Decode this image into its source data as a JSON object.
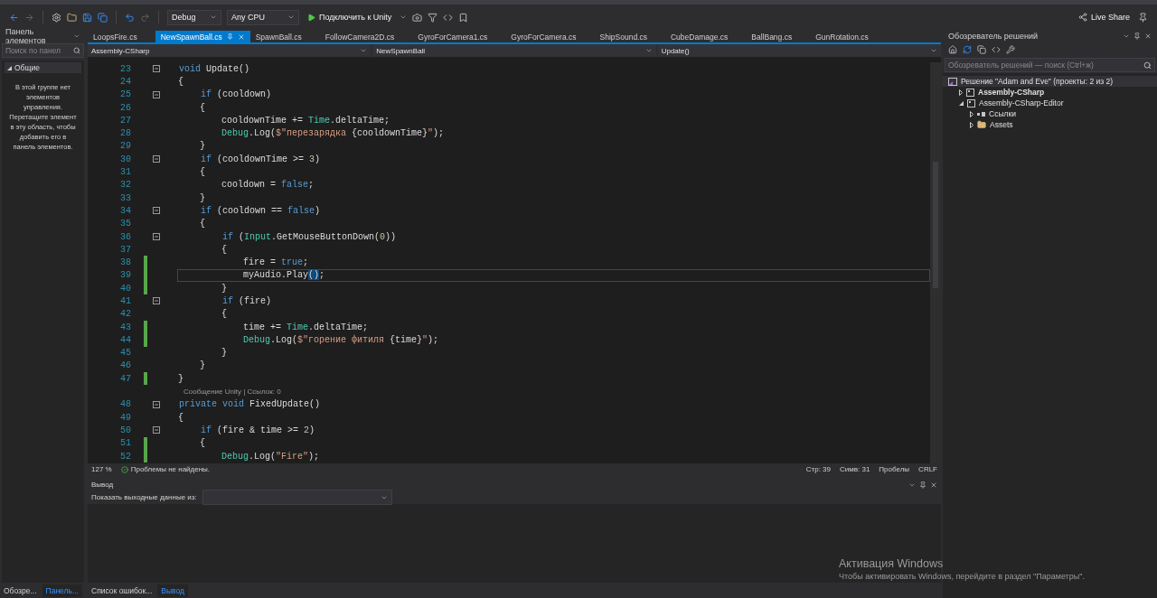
{
  "toolbar": {
    "config": "Debug",
    "platform": "Any CPU",
    "run_label": "Подключить к Unity",
    "live_share": "Live Share"
  },
  "toolbox": {
    "title": "Панель элементов",
    "search": {
      "placeholder": "Поиск по панел"
    },
    "group": {
      "label": "Общие",
      "expanded": true
    },
    "message": "В этой группе нет элементов управления. Перетащите элемент в эту область, чтобы добавить его в панель элементов."
  },
  "tabs": [
    {
      "label": "LoopsFire.cs",
      "selected": false
    },
    {
      "label": "NewSpawnBall.cs",
      "selected": true
    },
    {
      "label": "SpawnBall.cs",
      "selected": false
    },
    {
      "label": "FollowCamera2D.cs",
      "selected": false
    },
    {
      "label": "GyroForCamera1.cs",
      "selected": false
    },
    {
      "label": "GyroForCamera.cs",
      "selected": false
    },
    {
      "label": "ShipSound.cs",
      "selected": false
    },
    {
      "label": "CubeDamage.cs",
      "selected": false
    },
    {
      "label": "BallBang.cs",
      "selected": false
    },
    {
      "label": "GunRotation.cs",
      "selected": false
    }
  ],
  "navbar": {
    "project": "Assembly-CSharp",
    "class": "NewSpawnBall",
    "member": "Update()"
  },
  "code": [
    {
      "kind": "code",
      "number": "23",
      "fold": true,
      "changed": false,
      "current": false,
      "tokens": [
        {
          "kind": "kw",
          "text": "void "
        },
        {
          "kind": "p",
          "text": "Update()"
        }
      ]
    },
    {
      "kind": "code",
      "number": "24",
      "fold": false,
      "changed": false,
      "current": false,
      "tokens": [
        {
          "kind": "p",
          "text": "{"
        }
      ]
    },
    {
      "kind": "code",
      "number": "25",
      "fold": true,
      "changed": false,
      "current": false,
      "tokens": [
        {
          "kind": "kw",
          "text": "    if"
        },
        {
          "kind": "p",
          "text": " (cooldown)"
        }
      ]
    },
    {
      "kind": "code",
      "number": "26",
      "fold": false,
      "changed": false,
      "current": false,
      "tokens": [
        {
          "kind": "p",
          "text": "    {"
        }
      ]
    },
    {
      "kind": "code",
      "number": "27",
      "fold": false,
      "changed": false,
      "current": false,
      "tokens": [
        {
          "kind": "p",
          "text": "        cooldownTime += "
        },
        {
          "kind": "type",
          "text": "Time"
        },
        {
          "kind": "p",
          "text": ".deltaTime;"
        }
      ]
    },
    {
      "kind": "code",
      "number": "28",
      "fold": false,
      "changed": false,
      "current": false,
      "tokens": [
        {
          "kind": "type",
          "text": "        Debug"
        },
        {
          "kind": "p",
          "text": ".Log("
        },
        {
          "kind": "str",
          "text": "$\"перезарядка "
        },
        {
          "kind": "p",
          "text": "{cooldownTime}"
        },
        {
          "kind": "str",
          "text": "\""
        },
        {
          "kind": "p",
          "text": ");"
        }
      ]
    },
    {
      "kind": "code",
      "number": "29",
      "fold": false,
      "changed": false,
      "current": false,
      "tokens": [
        {
          "kind": "p",
          "text": "    }"
        }
      ]
    },
    {
      "kind": "code",
      "number": "30",
      "fold": true,
      "changed": false,
      "current": false,
      "tokens": [
        {
          "kind": "kw",
          "text": "    if"
        },
        {
          "kind": "p",
          "text": " (cooldownTime >= "
        },
        {
          "kind": "num",
          "text": "3"
        },
        {
          "kind": "p",
          "text": ")"
        }
      ]
    },
    {
      "kind": "code",
      "number": "31",
      "fold": false,
      "changed": false,
      "current": false,
      "tokens": [
        {
          "kind": "p",
          "text": "    {"
        }
      ]
    },
    {
      "kind": "code",
      "number": "32",
      "fold": false,
      "changed": false,
      "current": false,
      "tokens": [
        {
          "kind": "p",
          "text": "        cooldown = "
        },
        {
          "kind": "kw",
          "text": "false"
        },
        {
          "kind": "p",
          "text": ";"
        }
      ]
    },
    {
      "kind": "code",
      "number": "33",
      "fold": false,
      "changed": false,
      "current": false,
      "tokens": [
        {
          "kind": "p",
          "text": "    }"
        }
      ]
    },
    {
      "kind": "code",
      "number": "34",
      "fold": true,
      "changed": false,
      "current": false,
      "tokens": [
        {
          "kind": "kw",
          "text": "    if"
        },
        {
          "kind": "p",
          "text": " (cooldown == "
        },
        {
          "kind": "kw",
          "text": "false"
        },
        {
          "kind": "p",
          "text": ")"
        }
      ]
    },
    {
      "kind": "code",
      "number": "35",
      "fold": false,
      "changed": false,
      "current": false,
      "tokens": [
        {
          "kind": "p",
          "text": "    {"
        }
      ]
    },
    {
      "kind": "code",
      "number": "36",
      "fold": true,
      "changed": false,
      "current": false,
      "tokens": [
        {
          "kind": "kw",
          "text": "        if"
        },
        {
          "kind": "p",
          "text": " ("
        },
        {
          "kind": "type",
          "text": "Input"
        },
        {
          "kind": "p",
          "text": ".GetMouseButtonDown("
        },
        {
          "kind": "num",
          "text": "0"
        },
        {
          "kind": "p",
          "text": "))"
        }
      ]
    },
    {
      "kind": "code",
      "number": "37",
      "fold": false,
      "changed": false,
      "current": false,
      "tokens": [
        {
          "kind": "p",
          "text": "        {"
        }
      ]
    },
    {
      "kind": "code",
      "number": "38",
      "fold": false,
      "changed": true,
      "current": false,
      "tokens": [
        {
          "kind": "p",
          "text": "            fire = "
        },
        {
          "kind": "kw",
          "text": "true"
        },
        {
          "kind": "p",
          "text": ";"
        }
      ]
    },
    {
      "kind": "code",
      "number": "39",
      "fold": false,
      "changed": true,
      "current": true,
      "tokens": [
        {
          "kind": "p",
          "text": "            myAudio.Play"
        },
        {
          "kind": "match",
          "text": "()"
        },
        {
          "kind": "p",
          "text": ";"
        }
      ]
    },
    {
      "kind": "code",
      "number": "40",
      "fold": false,
      "changed": true,
      "current": false,
      "tokens": [
        {
          "kind": "p",
          "text": "        }"
        }
      ]
    },
    {
      "kind": "code",
      "number": "41",
      "fold": true,
      "changed": false,
      "current": false,
      "tokens": [
        {
          "kind": "kw",
          "text": "        if"
        },
        {
          "kind": "p",
          "text": " (fire)"
        }
      ]
    },
    {
      "kind": "code",
      "number": "42",
      "fold": false,
      "changed": false,
      "current": false,
      "tokens": [
        {
          "kind": "p",
          "text": "        {"
        }
      ]
    },
    {
      "kind": "code",
      "number": "43",
      "fold": false,
      "changed": true,
      "current": false,
      "tokens": [
        {
          "kind": "p",
          "text": "            time += "
        },
        {
          "kind": "type",
          "text": "Time"
        },
        {
          "kind": "p",
          "text": ".deltaTime;"
        }
      ]
    },
    {
      "kind": "code",
      "number": "44",
      "fold": false,
      "changed": true,
      "current": false,
      "tokens": [
        {
          "kind": "type",
          "text": "            Debug"
        },
        {
          "kind": "p",
          "text": ".Log("
        },
        {
          "kind": "str",
          "text": "$\"горение фитиля "
        },
        {
          "kind": "p",
          "text": "{time}"
        },
        {
          "kind": "str",
          "text": "\""
        },
        {
          "kind": "p",
          "text": ");"
        }
      ]
    },
    {
      "kind": "code",
      "number": "45",
      "fold": false,
      "changed": false,
      "current": false,
      "tokens": [
        {
          "kind": "p",
          "text": "        }"
        }
      ]
    },
    {
      "kind": "code",
      "number": "46",
      "fold": false,
      "changed": false,
      "current": false,
      "tokens": [
        {
          "kind": "p",
          "text": "    }"
        }
      ]
    },
    {
      "kind": "code",
      "number": "47",
      "fold": false,
      "changed": true,
      "current": false,
      "tokens": [
        {
          "kind": "p",
          "text": "}"
        }
      ]
    },
    {
      "kind": "lens",
      "text": "Сообщение Unity | Ссылок: 0"
    },
    {
      "kind": "code",
      "number": "48",
      "fold": true,
      "changed": false,
      "current": false,
      "tokens": [
        {
          "kind": "kw",
          "text": "private void "
        },
        {
          "kind": "p",
          "text": "FixedUpdate()"
        }
      ]
    },
    {
      "kind": "code",
      "number": "49",
      "fold": false,
      "changed": false,
      "current": false,
      "tokens": [
        {
          "kind": "p",
          "text": "{"
        }
      ]
    },
    {
      "kind": "code",
      "number": "50",
      "fold": true,
      "changed": false,
      "current": false,
      "tokens": [
        {
          "kind": "kw",
          "text": "    if"
        },
        {
          "kind": "p",
          "text": " (fire & time >= "
        },
        {
          "kind": "num",
          "text": "2"
        },
        {
          "kind": "p",
          "text": ")"
        }
      ]
    },
    {
      "kind": "code",
      "number": "51",
      "fold": false,
      "changed": true,
      "current": false,
      "tokens": [
        {
          "kind": "p",
          "text": "    {"
        }
      ]
    },
    {
      "kind": "code",
      "number": "52",
      "fold": false,
      "changed": true,
      "current": false,
      "tokens": [
        {
          "kind": "type",
          "text": "        Debug"
        },
        {
          "kind": "p",
          "text": ".Log("
        },
        {
          "kind": "str",
          "text": "\"Fire\""
        },
        {
          "kind": "p",
          "text": ");"
        }
      ]
    }
  ],
  "status": {
    "zoom": "127 %",
    "issues": "Проблемы не найдены.",
    "line": "Стр: 39",
    "column": "Симв: 31",
    "indent": "Пробелы",
    "eol": "CRLF"
  },
  "output": {
    "title": "Вывод",
    "source_label": "Показать выходные данные из:"
  },
  "bottom_tabs_left": [
    {
      "label": "Обозре...",
      "selected": false
    },
    {
      "label": "Панель...",
      "selected": true
    }
  ],
  "bottom_tabs_main": [
    {
      "label": "Список ошибок...",
      "selected": false
    },
    {
      "label": "Вывод",
      "selected": true
    }
  ],
  "solution_explorer": {
    "title": "Обозреватель решений",
    "search": {
      "placeholder": "Обозреватель решений — поиск (Ctrl+ж)"
    },
    "tree": [
      {
        "label": "Решение \"Adam and Eve\" (проекты: 2 из 2)",
        "kind": "solution",
        "bold": false,
        "children": [
          {
            "label": "Assembly-CSharp",
            "kind": "project",
            "bold": true,
            "expanded": false
          },
          {
            "label": "Assembly-CSharp-Editor",
            "kind": "project",
            "bold": false,
            "expanded": true,
            "children": [
              {
                "label": "Ссылки",
                "kind": "references",
                "bold": false,
                "expanded": false
              },
              {
                "label": "Assets",
                "kind": "folder",
                "bold": false,
                "expanded": false
              }
            ]
          }
        ]
      }
    ]
  },
  "activation": {
    "title": "Активация Windows",
    "text": "Чтобы активировать Windows, перейдите в раздел \"Параметры\"."
  }
}
